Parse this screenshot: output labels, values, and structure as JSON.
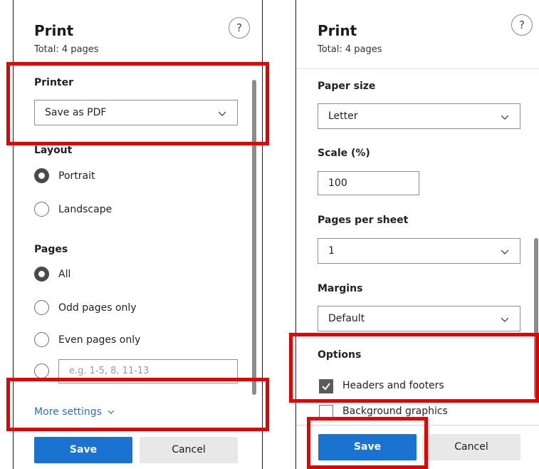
{
  "left_panel": {
    "title": "Print",
    "subtitle": "Total: 4 pages",
    "help_glyph": "?",
    "printer": {
      "label": "Printer",
      "value": "Save as PDF"
    },
    "layout": {
      "label": "Layout",
      "options": [
        "Portrait",
        "Landscape"
      ],
      "selected": "Portrait"
    },
    "pages": {
      "label": "Pages",
      "options": [
        "All",
        "Odd pages only",
        "Even pages only"
      ],
      "selected": "All",
      "custom_placeholder": "e.g. 1-5, 8, 11-13"
    },
    "more_settings": "More settings",
    "save_label": "Save",
    "cancel_label": "Cancel"
  },
  "right_panel": {
    "title": "Print",
    "subtitle": "Total: 4 pages",
    "help_glyph": "?",
    "paper_size": {
      "label": "Paper size",
      "value": "Letter"
    },
    "scale": {
      "label": "Scale (%)",
      "value": "100"
    },
    "pages_per_sheet": {
      "label": "Pages per sheet",
      "value": "1"
    },
    "margins": {
      "label": "Margins",
      "value": "Default"
    },
    "options": {
      "label": "Options",
      "items": [
        {
          "label": "Headers and footers",
          "checked": true
        },
        {
          "label": "Background graphics",
          "checked": false
        }
      ]
    },
    "save_label": "Save",
    "cancel_label": "Cancel"
  },
  "colors": {
    "primary_button": "#1a73d1",
    "link": "#2b6fc4",
    "highlight_box": "#e60000"
  },
  "icons": [
    "help-icon",
    "chevron-down-icon",
    "checkmark-icon"
  ]
}
